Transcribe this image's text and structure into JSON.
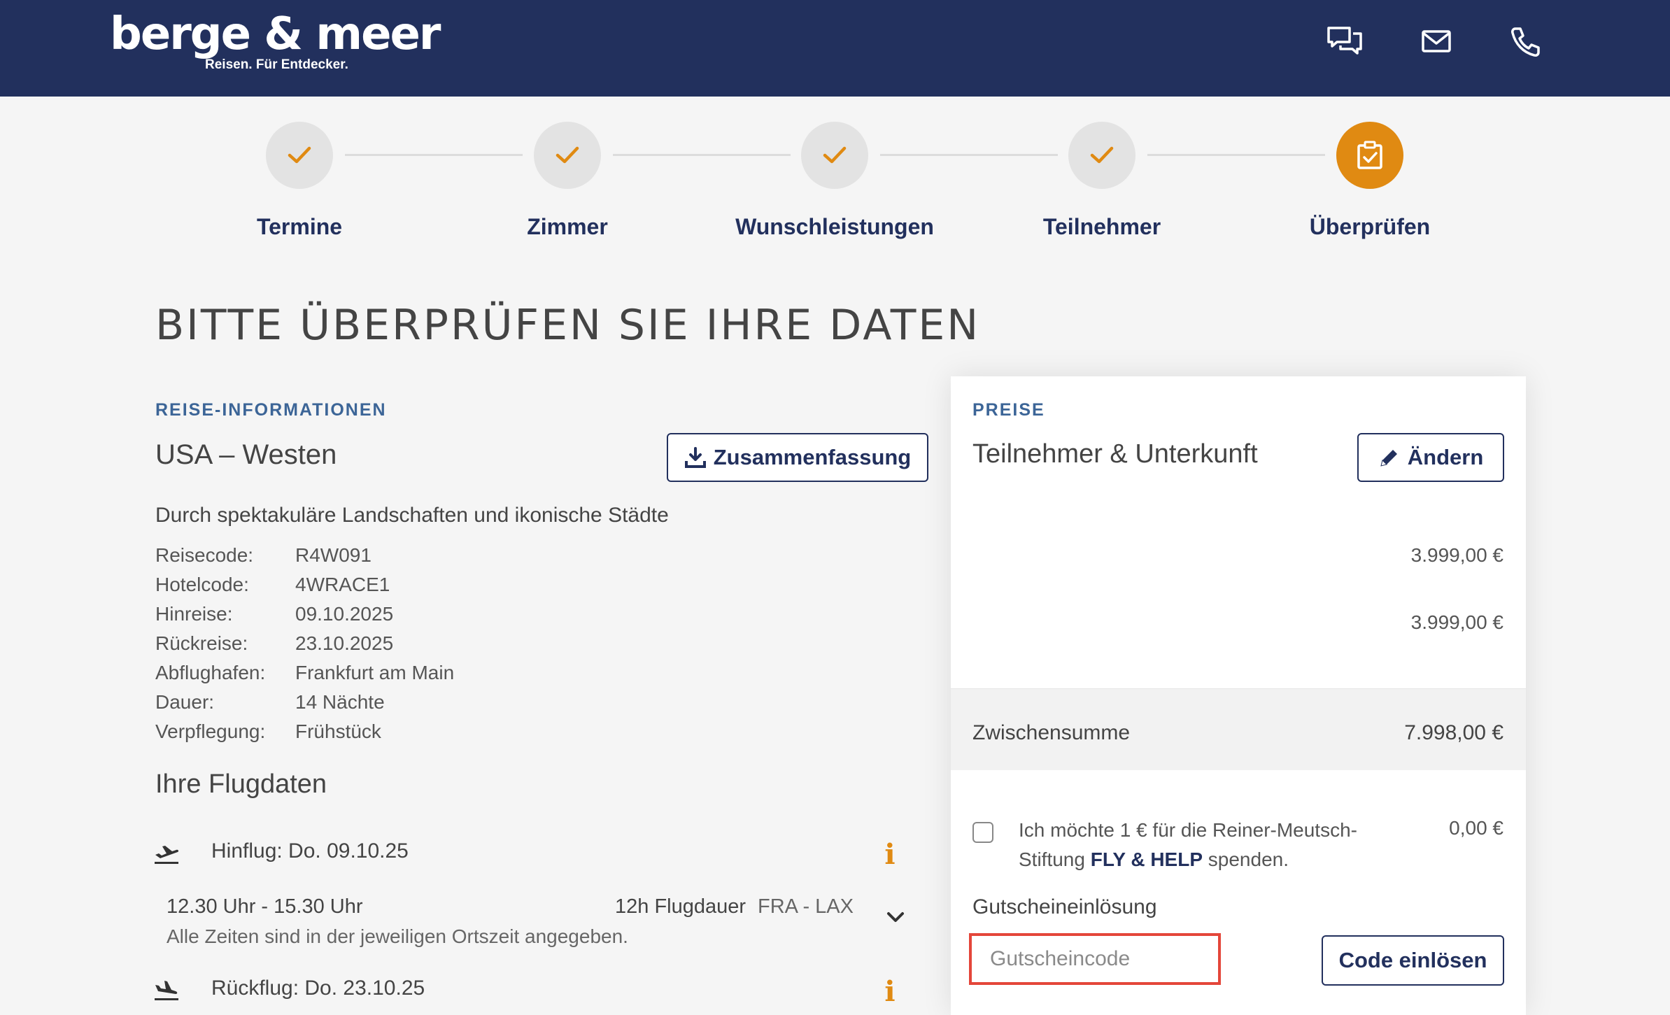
{
  "header": {
    "logo_text": "berge & meer",
    "logo_tagline": "Reisen. Für Entdecker.",
    "icons": [
      "chat-icon",
      "mail-icon",
      "phone-icon"
    ],
    "background_color": "#22305d"
  },
  "steps": [
    {
      "label": "Termine",
      "done": true
    },
    {
      "label": "Zimmer",
      "done": true
    },
    {
      "label": "Wunschleistungen",
      "done": true
    },
    {
      "label": "Teilnehmer",
      "done": true
    },
    {
      "label": "Überprüfen",
      "active": true
    }
  ],
  "page_title": "BITTE ÜBERPRÜFEN SIE IHRE DATEN",
  "trip": {
    "section_label": "REISE-INFORMATIONEN",
    "title": "USA – Westen",
    "summary_button": "Zusammenfassung",
    "subtitle": "Durch spektakuläre Landschaften und ikonische Städte",
    "details": [
      {
        "label": "Reisecode:",
        "value": "R4W091"
      },
      {
        "label": "Hotelcode:",
        "value": "4WRACE1"
      },
      {
        "label": "Hinreise:",
        "value": "09.10.2025"
      },
      {
        "label": "Rückreise:",
        "value": "23.10.2025"
      },
      {
        "label": "Abflughafen:",
        "value": "Frankfurt am Main"
      },
      {
        "label": "Dauer:",
        "value": "14 Nächte"
      },
      {
        "label": "Verpflegung:",
        "value": "Frühstück"
      }
    ]
  },
  "flights": {
    "heading": "Ihre Flugdaten",
    "outbound": {
      "label": "Hinflug: Do. 09.10.25",
      "times": "12.30 Uhr - 15.30 Uhr",
      "duration": "12h Flugdauer",
      "route": "FRA - LAX",
      "note": "Alle Zeiten sind in der jeweiligen Ortszeit angegeben."
    },
    "return": {
      "label": "Rückflug: Do. 23.10.25"
    }
  },
  "prices": {
    "section_label": "PREISE",
    "title": "Teilnehmer & Unterkunft",
    "edit_button": "Ändern",
    "items": [
      "3.999,00 €",
      "3.999,00 €"
    ],
    "subtotal_label": "Zwischensumme",
    "subtotal_value": "7.998,00 €",
    "donation_text_1": "Ich möchte 1 € für die Reiner-Meutsch-Stiftung ",
    "donation_brand": "FLY & HELP",
    "donation_text_2": " spenden.",
    "donation_price": "0,00 €",
    "voucher_label": "Gutscheineinlösung",
    "voucher_placeholder": "Gutscheincode",
    "voucher_button": "Code einlösen"
  },
  "colors": {
    "accent": "#e08a12",
    "navy": "#22305d",
    "section_blue": "#3c6597",
    "highlight_red": "#e4463a"
  }
}
